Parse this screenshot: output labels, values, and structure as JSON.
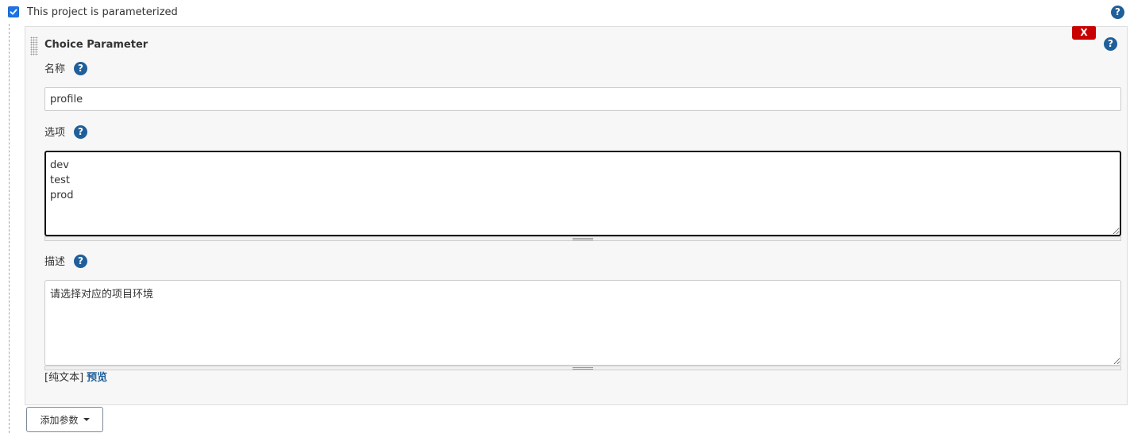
{
  "parameterized": {
    "checked": true,
    "label": "This project is parameterized",
    "help_icon": "question-mark-icon"
  },
  "choice_parameter": {
    "title": "Choice Parameter",
    "delete_label": "X",
    "name": {
      "label": "名称",
      "value": "profile"
    },
    "choices": {
      "label": "选项",
      "value": "dev\ntest\nprod"
    },
    "description": {
      "label": "描述",
      "value": "请选择对应的项目环境",
      "format_label": "[纯文本]",
      "preview_label": "预览"
    }
  },
  "add_parameter": {
    "label": "添加参数",
    "icon": "caret-down-icon"
  },
  "colors": {
    "accent": "#1f5f9a",
    "delete": "#c90000",
    "checkbox": "#1a73e8"
  }
}
